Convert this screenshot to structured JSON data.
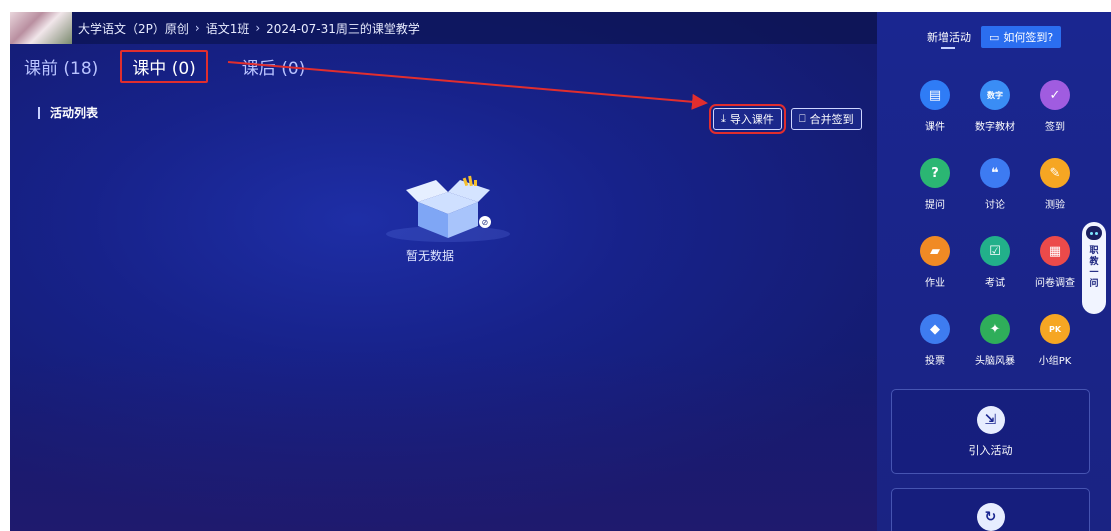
{
  "breadcrumb": {
    "course": "大学语文（2P）原创",
    "sep": "›",
    "class_name": "语文1班",
    "session": "2024-07-31周三的课堂教学"
  },
  "tabs": [
    {
      "label": "课前 (18)"
    },
    {
      "label": "课中 (0)",
      "active": true
    },
    {
      "label": "课后 (0)"
    }
  ],
  "section": {
    "title": "活动列表"
  },
  "actions": {
    "import_label": "导入课件",
    "merge_label": "合并签到"
  },
  "empty": {
    "label": "暂无数据"
  },
  "sidebar": {
    "header_title": "新增活动",
    "how_label": "如何签到?",
    "tools": [
      {
        "label": "课件",
        "icon": "courseware-icon",
        "color": "#2f7cf6",
        "glyph": "▤"
      },
      {
        "label": "数字教材",
        "icon": "digital-textbook-icon",
        "color": "#3a8df5",
        "glyph": "数字"
      },
      {
        "label": "签到",
        "icon": "checkin-icon",
        "color": "#a05ce0",
        "glyph": "✓"
      },
      {
        "label": "提问",
        "icon": "question-icon",
        "color": "#2bb673",
        "glyph": "?"
      },
      {
        "label": "讨论",
        "icon": "discussion-icon",
        "color": "#3d7bf2",
        "glyph": "❝"
      },
      {
        "label": "测验",
        "icon": "quiz-icon",
        "color": "#f6a623",
        "glyph": "✎"
      },
      {
        "label": "作业",
        "icon": "homework-icon",
        "color": "#f08a24",
        "glyph": "▰"
      },
      {
        "label": "考试",
        "icon": "exam-icon",
        "color": "#22b08a",
        "glyph": "☑"
      },
      {
        "label": "问卷调查",
        "icon": "survey-icon",
        "color": "#ec4a4a",
        "glyph": "▦"
      },
      {
        "label": "投票",
        "icon": "vote-icon",
        "color": "#3e7cf0",
        "glyph": "◆"
      },
      {
        "label": "头脑风暴",
        "icon": "brainstorm-icon",
        "color": "#2fae5a",
        "glyph": "✦"
      },
      {
        "label": "小组PK",
        "icon": "group-pk-icon",
        "color": "#f6a623",
        "glyph": "PK"
      }
    ],
    "import_activity_label": "引入活动"
  },
  "robot": {
    "chars": [
      "职",
      "教",
      "一",
      "问"
    ]
  },
  "colors": {
    "highlight": "#e12e2e",
    "accent": "#2b6ef0"
  }
}
